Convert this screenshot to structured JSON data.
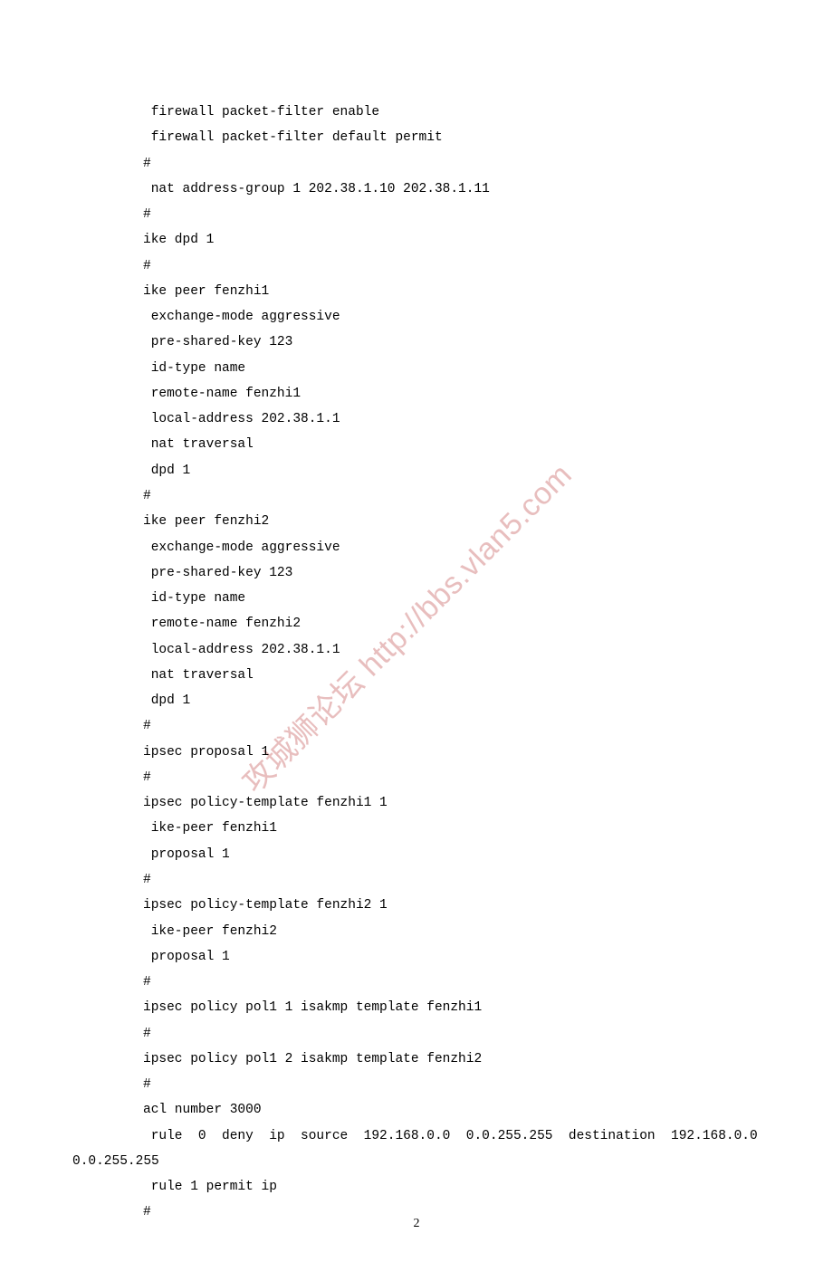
{
  "lines": [
    {
      "cls": "indent",
      "text": " firewall packet-filter enable"
    },
    {
      "cls": "indent",
      "text": " firewall packet-filter default permit"
    },
    {
      "cls": "indent",
      "text": "#"
    },
    {
      "cls": "indent",
      "text": " nat address-group 1 202.38.1.10 202.38.1.11"
    },
    {
      "cls": "indent",
      "text": "#"
    },
    {
      "cls": "indent",
      "text": "ike dpd 1"
    },
    {
      "cls": "indent",
      "text": "#"
    },
    {
      "cls": "indent",
      "text": "ike peer fenzhi1"
    },
    {
      "cls": "indent",
      "text": " exchange-mode aggressive"
    },
    {
      "cls": "indent",
      "text": " pre-shared-key 123"
    },
    {
      "cls": "indent",
      "text": " id-type name"
    },
    {
      "cls": "indent",
      "text": " remote-name fenzhi1"
    },
    {
      "cls": "indent",
      "text": " local-address 202.38.1.1"
    },
    {
      "cls": "indent",
      "text": " nat traversal"
    },
    {
      "cls": "indent",
      "text": " dpd 1"
    },
    {
      "cls": "indent",
      "text": "#"
    },
    {
      "cls": "indent",
      "text": "ike peer fenzhi2"
    },
    {
      "cls": "indent",
      "text": " exchange-mode aggressive"
    },
    {
      "cls": "indent",
      "text": " pre-shared-key 123"
    },
    {
      "cls": "indent",
      "text": " id-type name"
    },
    {
      "cls": "indent",
      "text": " remote-name fenzhi2"
    },
    {
      "cls": "indent",
      "text": " local-address 202.38.1.1"
    },
    {
      "cls": "indent",
      "text": " nat traversal"
    },
    {
      "cls": "indent",
      "text": " dpd 1"
    },
    {
      "cls": "indent",
      "text": "#"
    },
    {
      "cls": "indent",
      "text": "ipsec proposal 1"
    },
    {
      "cls": "indent",
      "text": "#"
    },
    {
      "cls": "indent",
      "text": "ipsec policy-template fenzhi1 1"
    },
    {
      "cls": "indent",
      "text": " ike-peer fenzhi1"
    },
    {
      "cls": "indent",
      "text": " proposal 1"
    },
    {
      "cls": "indent",
      "text": "#"
    },
    {
      "cls": "indent",
      "text": "ipsec policy-template fenzhi2 1"
    },
    {
      "cls": "indent",
      "text": " ike-peer fenzhi2"
    },
    {
      "cls": "indent",
      "text": " proposal 1"
    },
    {
      "cls": "indent",
      "text": "#"
    },
    {
      "cls": "indent",
      "text": "ipsec policy pol1 1 isakmp template fenzhi1"
    },
    {
      "cls": "indent",
      "text": "#"
    },
    {
      "cls": "indent",
      "text": "ipsec policy pol1 2 isakmp template fenzhi2"
    },
    {
      "cls": "indent",
      "text": "#"
    },
    {
      "cls": "indent",
      "text": "acl number 3000"
    },
    {
      "cls": "indent",
      "text": " rule  0  deny  ip  source  192.168.0.0  0.0.255.255  destination  192.168.0.0"
    },
    {
      "cls": "wrap",
      "text": "0.0.255.255"
    },
    {
      "cls": "indent",
      "text": " rule 1 permit ip"
    },
    {
      "cls": "indent",
      "text": "#"
    }
  ],
  "watermark": "攻城狮论坛 http://bbs.vlan5.com",
  "page_number": "2"
}
